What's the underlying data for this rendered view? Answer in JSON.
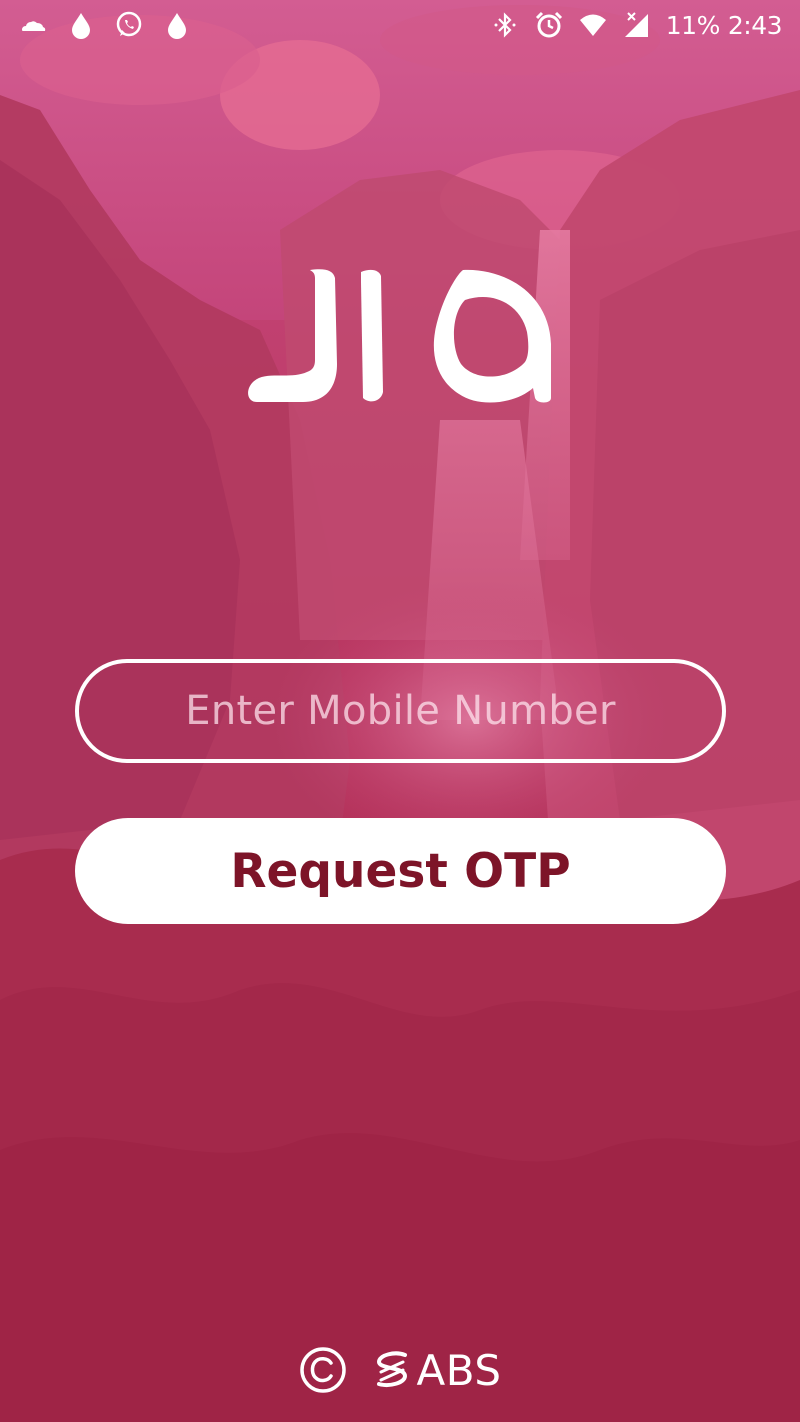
{
  "status_bar": {
    "left_icons": [
      "cloud-icon",
      "droplet-icon",
      "whatsapp-icon",
      "droplet-icon"
    ],
    "right_icons": [
      "bluetooth-icon",
      "alarm-icon",
      "wifi-icon",
      "signal-icon"
    ],
    "battery": "11%",
    "time": "2:43"
  },
  "logo": {
    "text": "JIA"
  },
  "login": {
    "mobile_placeholder": "Enter Mobile Number",
    "mobile_value": "",
    "request_otp_label": "Request OTP"
  },
  "footer": {
    "brand": "ABS",
    "icons": [
      "copyright-icon",
      "abs-logo-icon"
    ]
  },
  "colors": {
    "background_tint": "#c03a66",
    "button_text": "#7d1428",
    "foreground": "#ffffff"
  }
}
